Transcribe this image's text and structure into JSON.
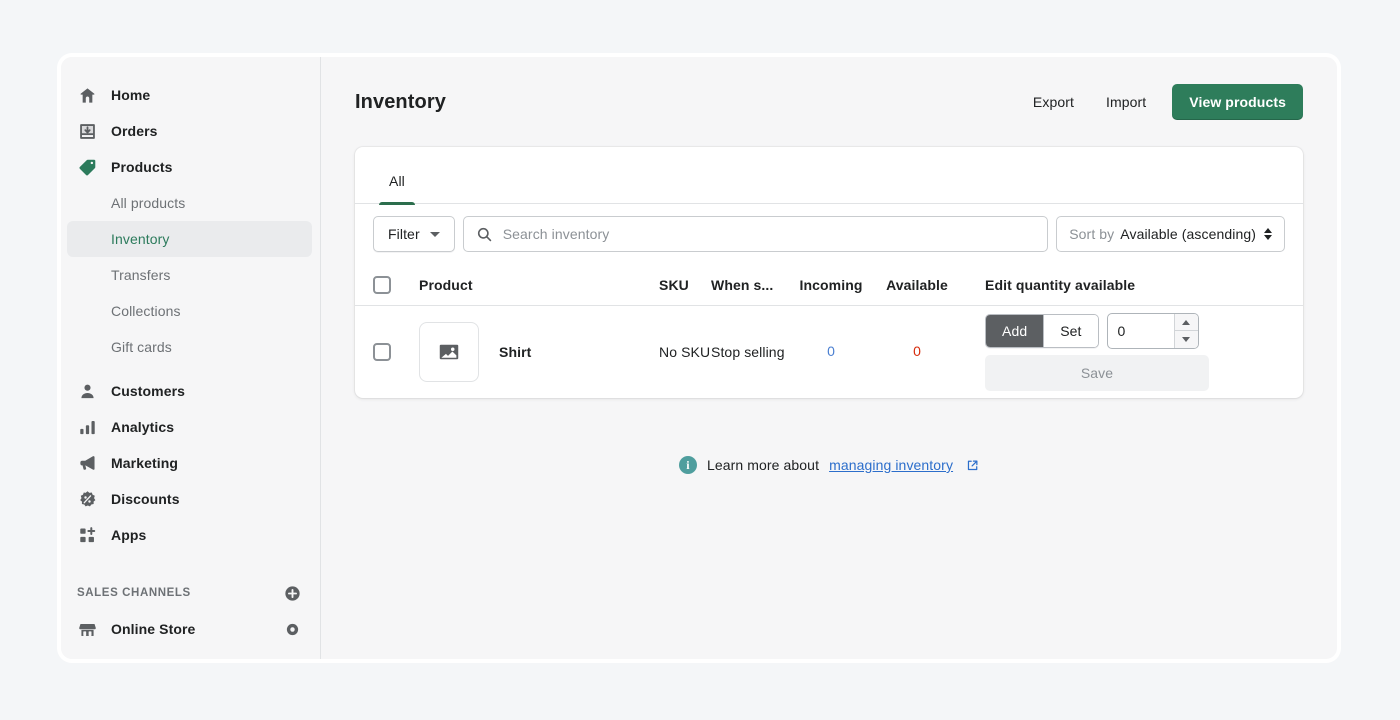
{
  "sidebar": {
    "items": [
      {
        "label": "Home",
        "icon": "home-icon"
      },
      {
        "label": "Orders",
        "icon": "orders-icon"
      },
      {
        "label": "Products",
        "icon": "products-tag-icon"
      }
    ],
    "sub_items": [
      {
        "label": "All products",
        "active": false
      },
      {
        "label": "Inventory",
        "active": true
      },
      {
        "label": "Transfers",
        "active": false
      },
      {
        "label": "Collections",
        "active": false
      },
      {
        "label": "Gift cards",
        "active": false
      }
    ],
    "items2": [
      {
        "label": "Customers",
        "icon": "customers-icon"
      },
      {
        "label": "Analytics",
        "icon": "analytics-icon"
      },
      {
        "label": "Marketing",
        "icon": "marketing-megaphone-icon"
      },
      {
        "label": "Discounts",
        "icon": "discounts-icon"
      },
      {
        "label": "Apps",
        "icon": "apps-icon"
      }
    ],
    "sales_channels": {
      "title": "SALES CHANNELS",
      "add_icon": "plus-circle-icon",
      "channels": [
        {
          "label": "Online Store",
          "icon": "store-icon",
          "action_icon": "eye-icon"
        }
      ]
    },
    "active_color": "#2c7b5c"
  },
  "header": {
    "title": "Inventory",
    "export_label": "Export",
    "import_label": "Import",
    "view_products_label": "View products",
    "primary_color": "#2e7d5b"
  },
  "tabs": [
    {
      "label": "All",
      "active": true
    }
  ],
  "filters": {
    "filter_label": "Filter",
    "search_placeholder": "Search inventory",
    "search_value": "",
    "search_icon": "search-icon",
    "sort_label": "Sort by",
    "sort_value": "Available (ascending)"
  },
  "table": {
    "columns": {
      "product": "Product",
      "sku": "SKU",
      "when_sold_out": "When s...",
      "incoming": "Incoming",
      "available": "Available",
      "edit_quantity": "Edit quantity available"
    },
    "rows": [
      {
        "product": "Shirt",
        "thumbnail_icon": "image-placeholder-icon",
        "sku": "No SKU",
        "when_sold_out": "Stop selling",
        "incoming": "0",
        "incoming_color": "#4a7fd1",
        "available": "0",
        "available_color": "#d72c0d",
        "editor": {
          "add_label": "Add",
          "set_label": "Set",
          "active_mode": "Add",
          "quantity_value": "0",
          "save_label": "Save",
          "save_disabled": true
        }
      }
    ]
  },
  "footer": {
    "info_icon": "info-circle-icon",
    "text": "Learn more about",
    "link_text": "managing inventory",
    "external_icon": "external-link-icon"
  }
}
